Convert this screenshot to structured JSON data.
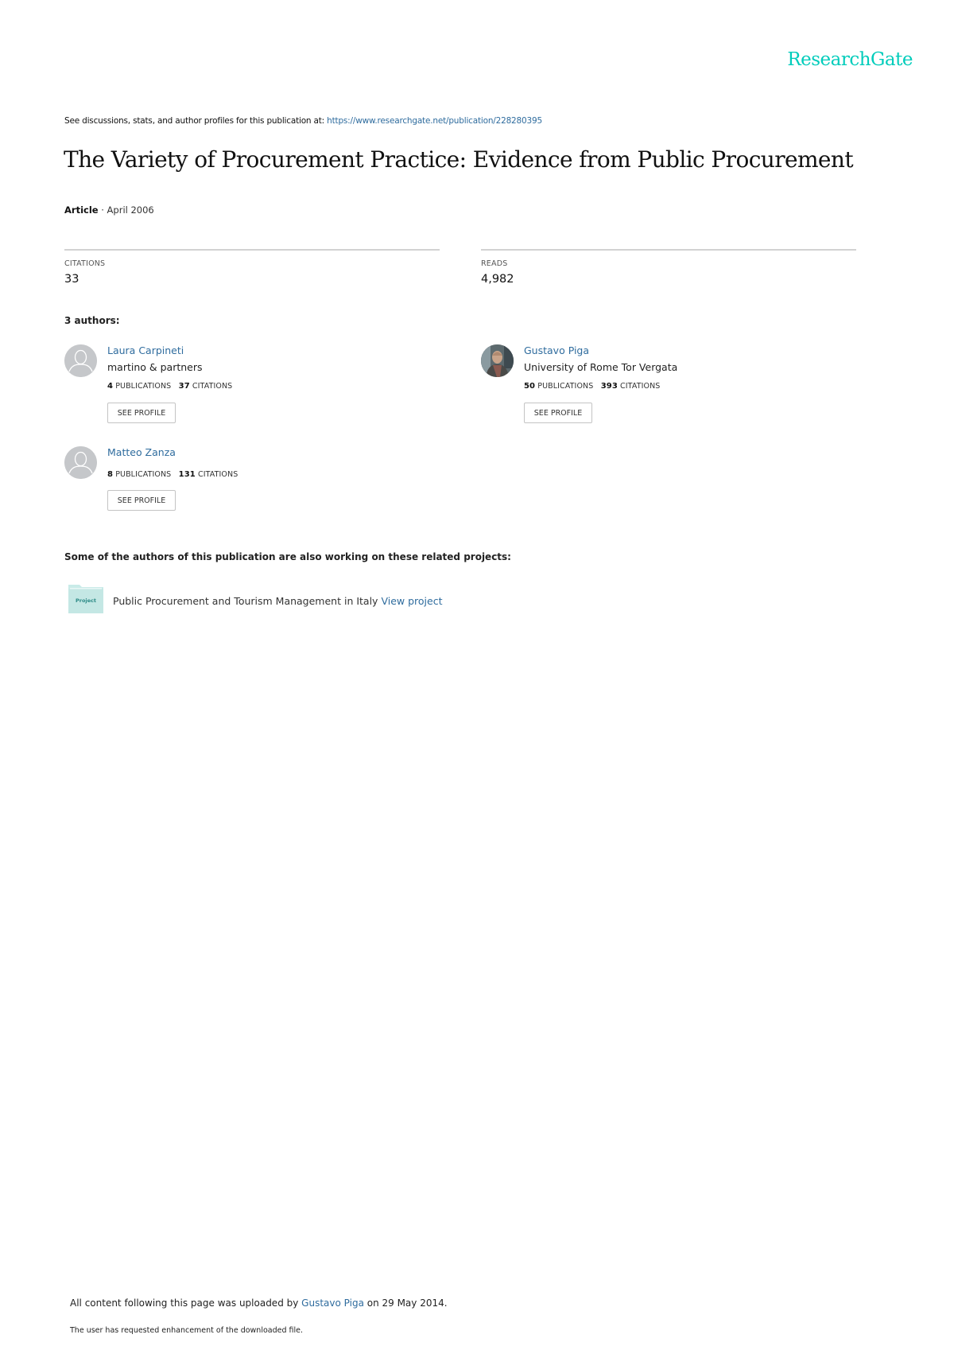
{
  "brand": {
    "logo_text": "ResearchGate",
    "accent_color": "#00ccbb",
    "link_color": "#2f6c9e"
  },
  "header": {
    "note_prefix": "See discussions, stats, and author profiles for this publication at: ",
    "url": "https://www.researchgate.net/publication/228280395"
  },
  "publication": {
    "title": "The Variety of Procurement Practice: Evidence from Public Procurement",
    "type": "Article",
    "separator": " · ",
    "date": "April 2006"
  },
  "stats": {
    "citations_label": "CITATIONS",
    "citations_value": "33",
    "reads_label": "READS",
    "reads_value": "4,982"
  },
  "authors_heading": "3 authors:",
  "authors": [
    {
      "name": "Laura Carpineti",
      "institution": "martino & partners",
      "publications": "4",
      "publications_label": "PUBLICATIONS",
      "citations": "37",
      "citations_label": "CITATIONS",
      "button": "SEE PROFILE",
      "avatar": "placeholder"
    },
    {
      "name": "Gustavo Piga",
      "institution": "University of Rome Tor Vergata",
      "publications": "50",
      "publications_label": "PUBLICATIONS",
      "citations": "393",
      "citations_label": "CITATIONS",
      "button": "SEE PROFILE",
      "avatar": "photo"
    },
    {
      "name": "Matteo Zanza",
      "institution": "",
      "publications": "8",
      "publications_label": "PUBLICATIONS",
      "citations": "131",
      "citations_label": "CITATIONS",
      "button": "SEE PROFILE",
      "avatar": "placeholder"
    }
  ],
  "projects": {
    "heading": "Some of the authors of this publication are also working on these related projects:",
    "items": [
      {
        "icon_label": "Project",
        "title": "Public Procurement and Tourism Management in Italy",
        "link": "View project"
      }
    ]
  },
  "footer": {
    "upload_prefix": "All content following this page was uploaded by ",
    "uploader": "Gustavo Piga",
    "upload_suffix": " on 29 May 2014.",
    "enhancement_note": "The user has requested enhancement of the downloaded file."
  }
}
